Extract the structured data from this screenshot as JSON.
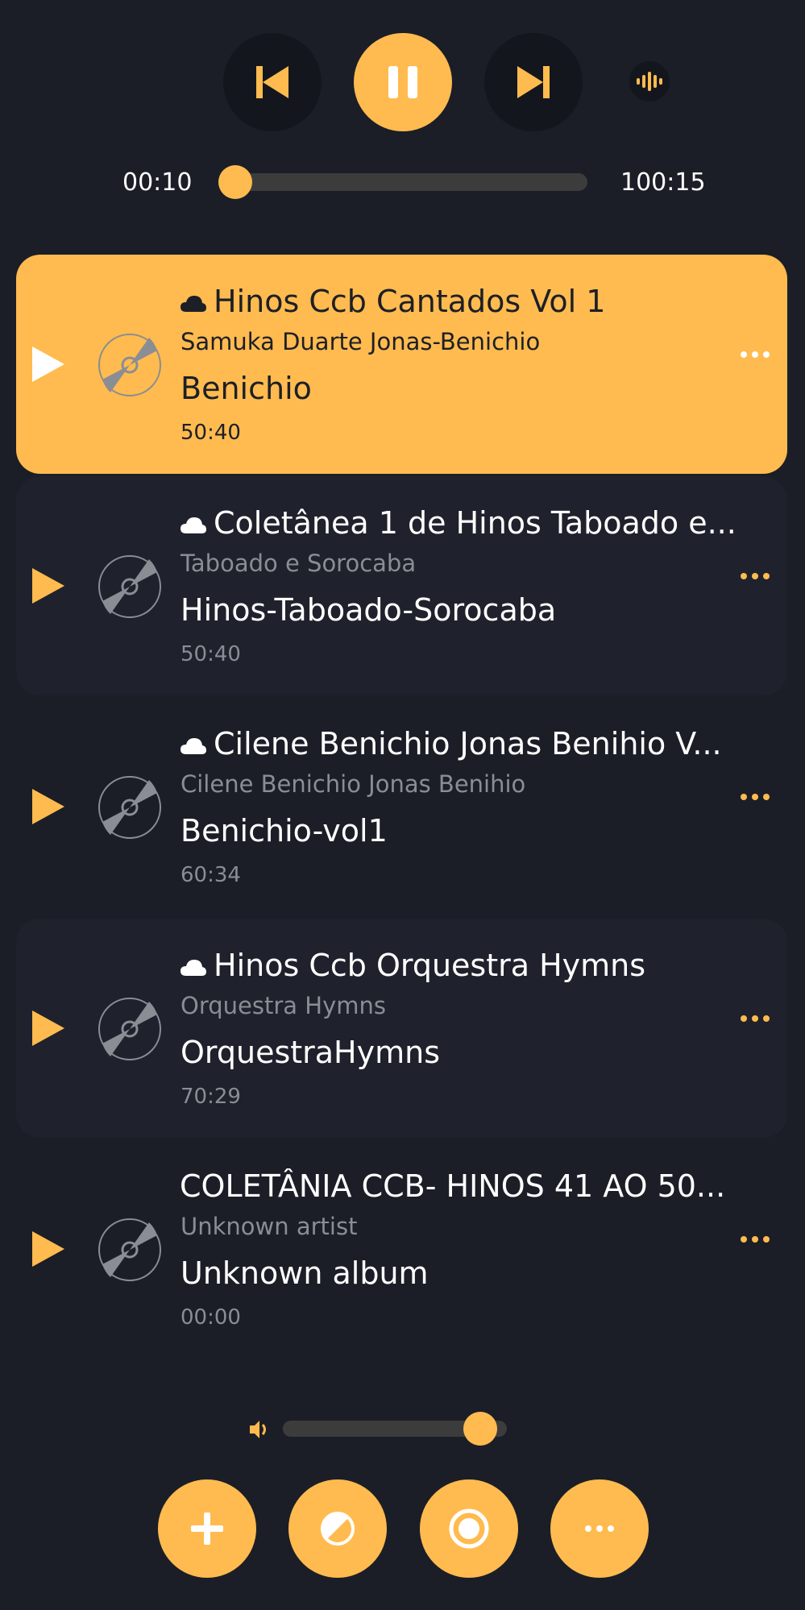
{
  "player": {
    "elapsed": "00:10",
    "total": "100:15",
    "progress": 0.02,
    "accent": "#ffbb4f",
    "controls": [
      "skip-previous-icon",
      "pause-icon",
      "skip-next-icon",
      "equalizer-icon"
    ]
  },
  "playlist": [
    {
      "title": "Hinos Ccb Cantados Vol 1",
      "artist": "Samuka Duarte Jonas-Benichio",
      "album": "Benichio",
      "duration": "50:40",
      "cloud": true,
      "active": true
    },
    {
      "title": "Coletânea 1 de Hinos Taboado e...",
      "artist": "Taboado e Sorocaba",
      "album": "Hinos-Taboado-Sorocaba",
      "duration": "50:40",
      "cloud": true,
      "active": false
    },
    {
      "title": "Cilene Benichio Jonas Benihio V...",
      "artist": "Cilene Benichio Jonas Benihio",
      "album": "Benichio-vol1",
      "duration": "60:34",
      "cloud": true,
      "active": false
    },
    {
      "title": "Hinos Ccb Orquestra Hymns",
      "artist": "Orquestra Hymns",
      "album": "OrquestraHymns",
      "duration": "70:29",
      "cloud": true,
      "active": false
    },
    {
      "title": "COLETÂNIA CCB- HINOS 41 AO 50...",
      "artist": "Unknown artist",
      "album": "Unknown album",
      "duration": "00:00",
      "cloud": false,
      "active": false
    }
  ],
  "volume": {
    "level": 0.95
  },
  "bottom_bar": [
    "add-icon",
    "theme-icon",
    "record-icon",
    "more-icon"
  ]
}
